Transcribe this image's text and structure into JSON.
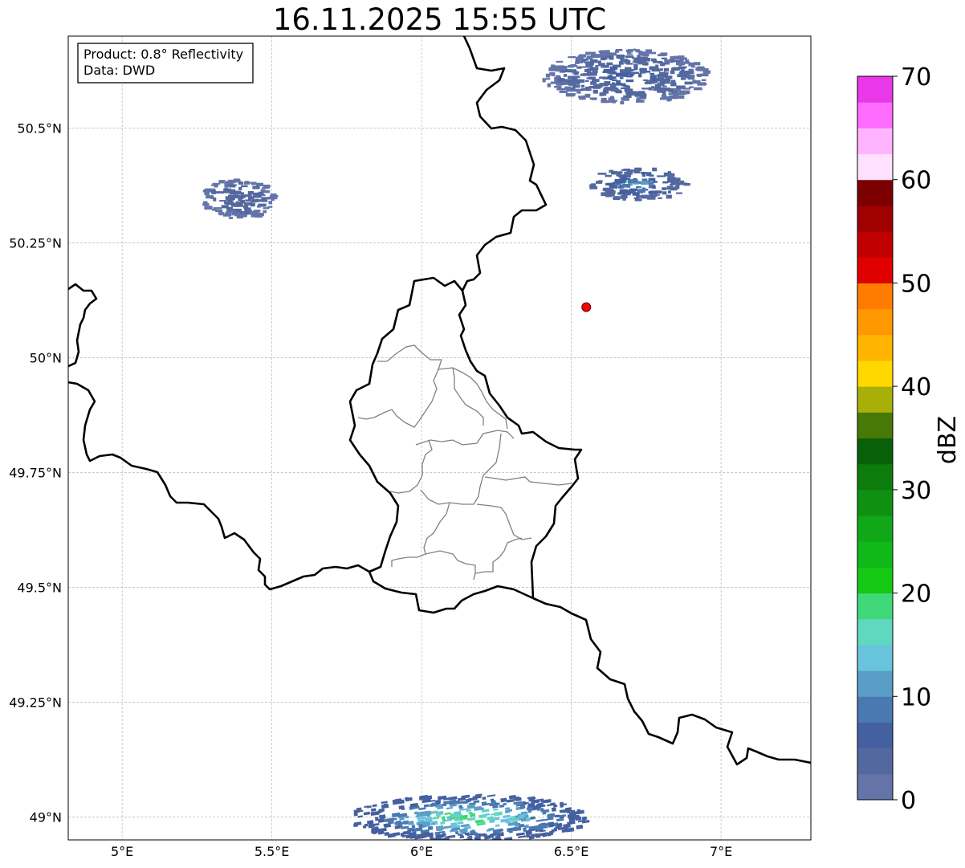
{
  "title": "16.11.2025 15:55 UTC",
  "info_box": {
    "product_line": "Product: 0.8° Reflectivity",
    "data_line": "Data: DWD"
  },
  "axes": {
    "lat_ticks": [
      {
        "value": 50.5,
        "label": "50.5°N"
      },
      {
        "value": 50.25,
        "label": "50.25°N"
      },
      {
        "value": 50.0,
        "label": "50°N"
      },
      {
        "value": 49.75,
        "label": "49.75°N"
      },
      {
        "value": 49.5,
        "label": "49.5°N"
      },
      {
        "value": 49.25,
        "label": "49.25°N"
      },
      {
        "value": 49.0,
        "label": "49°N"
      }
    ],
    "lon_ticks": [
      {
        "value": 5.0,
        "label": "5°E"
      },
      {
        "value": 5.5,
        "label": "5.5°E"
      },
      {
        "value": 6.0,
        "label": "6°E"
      },
      {
        "value": 6.5,
        "label": "6.5°E"
      },
      {
        "value": 7.0,
        "label": "7°E"
      }
    ],
    "lon_range": [
      4.82,
      7.3
    ],
    "lat_range": [
      48.95,
      50.7
    ],
    "grid": true
  },
  "radar_site": {
    "lon": 6.55,
    "lat": 50.11,
    "color": "#ff0000"
  },
  "colorbar": {
    "label": "dBZ",
    "min": 0,
    "max": 70,
    "step": 2.5,
    "tick_values": [
      0,
      10,
      20,
      30,
      40,
      50,
      60,
      70
    ],
    "tick_labels": [
      "0",
      "10",
      "20",
      "30",
      "40",
      "50",
      "60",
      "70"
    ],
    "colors": [
      "#6474a8",
      "#5468a0",
      "#4460a0",
      "#4a78b0",
      "#5a9ec8",
      "#68c4dc",
      "#60d8c0",
      "#40d878",
      "#14c814",
      "#10b818",
      "#10a818",
      "#109010",
      "#0c7c0c",
      "#086008",
      "#487808",
      "#a8b008",
      "#ffd800",
      "#ffb400",
      "#ff9800",
      "#ff7c00",
      "#e00000",
      "#c00000",
      "#a00000",
      "#7c0000",
      "#ffe0ff",
      "#ffb4ff",
      "#ff6cff",
      "#e838e8"
    ]
  },
  "chart_data": {
    "type": "heatmap",
    "title": "16.11.2025 15:55 UTC",
    "colorbar_label": "dBZ",
    "value_range": [
      0,
      70
    ],
    "regions": [
      {
        "lon_range": [
          6.4,
          6.95
        ],
        "lat_range": [
          50.55,
          50.68
        ],
        "approx_dbz": [
          2,
          8
        ]
      },
      {
        "lon_range": [
          6.55,
          6.88
        ],
        "lat_range": [
          50.34,
          50.42
        ],
        "approx_dbz": [
          3,
          14
        ]
      },
      {
        "lon_range": [
          5.26,
          5.5
        ],
        "lat_range": [
          50.3,
          50.4
        ],
        "approx_dbz": [
          2,
          6
        ]
      },
      {
        "lon_range": [
          5.75,
          6.55
        ],
        "lat_range": [
          48.95,
          49.05
        ],
        "approx_dbz": [
          5,
          25
        ]
      }
    ]
  }
}
